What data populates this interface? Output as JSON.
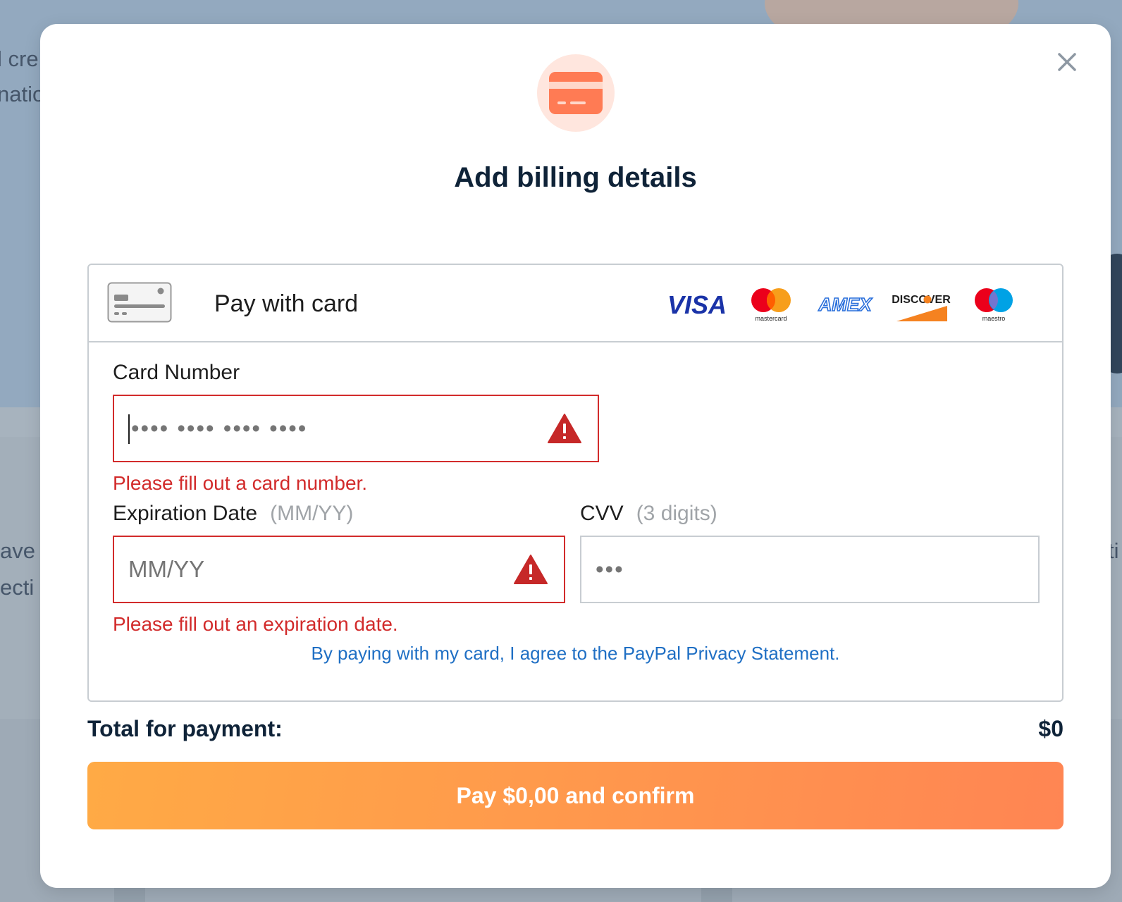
{
  "background": {
    "snippets": [
      "l cre",
      "natio",
      "ave",
      "ecti",
      "ti"
    ]
  },
  "modal": {
    "title": "Add billing details",
    "icons": {
      "close": "close-icon",
      "header": "credit-card-icon"
    },
    "colors": {
      "accent": "#ff7b54",
      "error": "#d22b2b",
      "link": "#1f6fc4",
      "title": "#0f2338"
    }
  },
  "card_panel": {
    "header_label": "Pay with card",
    "brands": [
      {
        "name": "VISA",
        "icon": "visa-logo"
      },
      {
        "name": "mastercard",
        "icon": "mastercard-logo"
      },
      {
        "name": "AMEX",
        "icon": "amex-logo"
      },
      {
        "name": "DISCOVER",
        "icon": "discover-logo"
      },
      {
        "name": "maestro",
        "icon": "maestro-logo"
      }
    ],
    "card_number": {
      "label": "Card Number",
      "placeholder": "•••• •••• •••• ••••",
      "value": "",
      "error": "Please fill out a card number."
    },
    "expiration": {
      "label": "Expiration Date",
      "hint": "(MM/YY)",
      "placeholder": "MM/YY",
      "value": "",
      "error": "Please fill out an expiration date."
    },
    "cvv": {
      "label": "CVV",
      "hint": "(3 digits)",
      "placeholder": "•••",
      "value": ""
    },
    "privacy_text": "By paying with my card, I agree to the PayPal Privacy Statement."
  },
  "total": {
    "label": "Total for payment:",
    "value": "$0"
  },
  "pay_button": {
    "label": "Pay $0,00 and confirm"
  }
}
